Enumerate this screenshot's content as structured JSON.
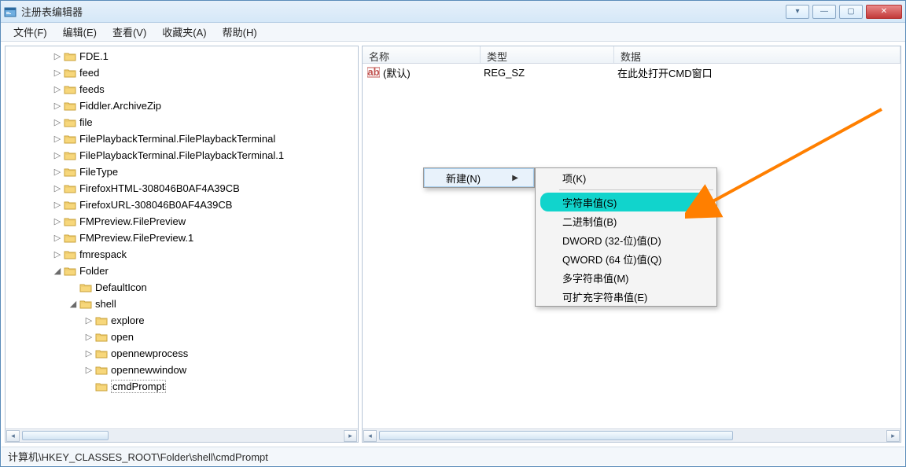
{
  "window": {
    "title": "注册表编辑器"
  },
  "menu": {
    "file": "文件(F)",
    "edit": "编辑(E)",
    "view": "查看(V)",
    "favorites": "收藏夹(A)",
    "help": "帮助(H)"
  },
  "tree": {
    "items": [
      {
        "expander": "▷",
        "label": "FDE.1",
        "indent": 0
      },
      {
        "expander": "▷",
        "label": "feed",
        "indent": 0
      },
      {
        "expander": "▷",
        "label": "feeds",
        "indent": 0
      },
      {
        "expander": "▷",
        "label": "Fiddler.ArchiveZip",
        "indent": 0
      },
      {
        "expander": "▷",
        "label": "file",
        "indent": 0
      },
      {
        "expander": "▷",
        "label": "FilePlaybackTerminal.FilePlaybackTerminal",
        "indent": 0
      },
      {
        "expander": "▷",
        "label": "FilePlaybackTerminal.FilePlaybackTerminal.1",
        "indent": 0
      },
      {
        "expander": "▷",
        "label": "FileType",
        "indent": 0
      },
      {
        "expander": "▷",
        "label": "FirefoxHTML-308046B0AF4A39CB",
        "indent": 0
      },
      {
        "expander": "▷",
        "label": "FirefoxURL-308046B0AF4A39CB",
        "indent": 0
      },
      {
        "expander": "▷",
        "label": "FMPreview.FilePreview",
        "indent": 0
      },
      {
        "expander": "▷",
        "label": "FMPreview.FilePreview.1",
        "indent": 0
      },
      {
        "expander": "▷",
        "label": "fmrespack",
        "indent": 0
      },
      {
        "expander": "◢",
        "label": "Folder",
        "indent": 0
      },
      {
        "expander": "",
        "label": "DefaultIcon",
        "indent": 1
      },
      {
        "expander": "◢",
        "label": "shell",
        "indent": 1
      },
      {
        "expander": "▷",
        "label": "explore",
        "indent": 2
      },
      {
        "expander": "▷",
        "label": "open",
        "indent": 2
      },
      {
        "expander": "▷",
        "label": "opennewprocess",
        "indent": 2
      },
      {
        "expander": "▷",
        "label": "opennewwindow",
        "indent": 2
      },
      {
        "expander": "",
        "label": "cmdPrompt",
        "indent": 2,
        "selected": true
      }
    ]
  },
  "columns": {
    "name": "名称",
    "type": "类型",
    "data": "数据"
  },
  "values": [
    {
      "name": "(默认)",
      "type": "REG_SZ",
      "data": "在此处打开CMD窗口"
    }
  ],
  "context_parent": {
    "new": "新建(N)"
  },
  "context_sub": {
    "key": "项(K)",
    "string": "字符串值(S)",
    "binary": "二进制值(B)",
    "dword": "DWORD (32-位)值(D)",
    "qword": "QWORD (64 位)值(Q)",
    "multi": "多字符串值(M)",
    "expand": "可扩充字符串值(E)"
  },
  "statusbar": {
    "path": "计算机\\HKEY_CLASSES_ROOT\\Folder\\shell\\cmdPrompt"
  }
}
